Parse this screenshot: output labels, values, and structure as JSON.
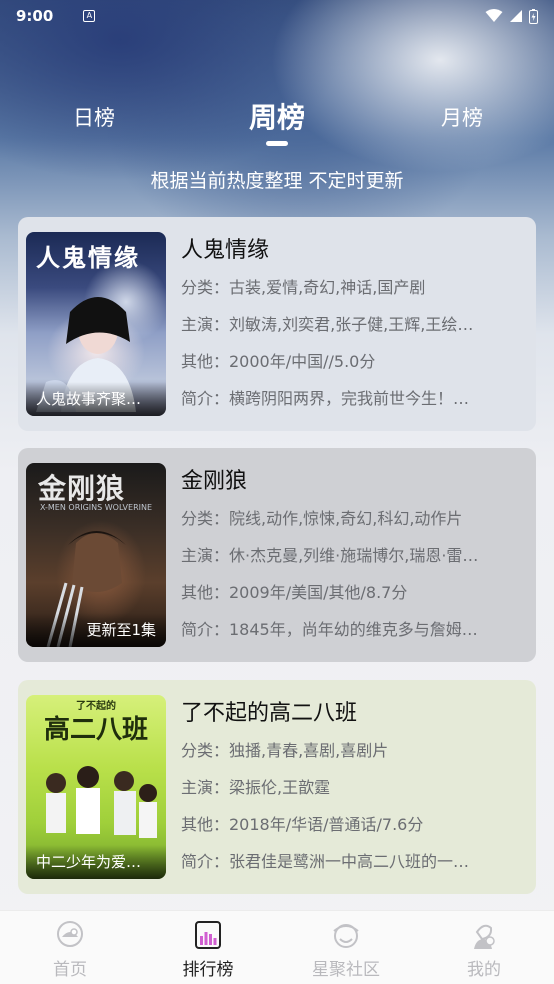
{
  "status_bar": {
    "time": "9:00",
    "notif_letter": "A"
  },
  "tabs": [
    {
      "label": "日榜",
      "active": false
    },
    {
      "label": "周榜",
      "active": true
    },
    {
      "label": "月榜",
      "active": false
    }
  ],
  "subtitle": "根据当前热度整理 不定时更新",
  "items": [
    {
      "title": "人鬼情缘",
      "poster_title": "人鬼情缘",
      "poster_caption": "人鬼故事齐聚…",
      "category": "分类：古装,爱情,奇幻,神话,国产剧",
      "cast": "主演：刘敏涛,刘奕君,张子健,王辉,王绘…",
      "other": "其他：2000年/中国//5.0分",
      "intro": "简介：横跨阴阳两界，完我前世今生！…"
    },
    {
      "title": "金刚狼",
      "poster_title": "金刚狼",
      "poster_subtitle": "X-MEN ORIGINS WOLVERINE",
      "poster_caption": "更新至1集",
      "category": "分类：院线,动作,惊悚,奇幻,科幻,动作片",
      "cast": "主演：休·杰克曼,列维·施瑞博尔,瑞恩·雷…",
      "other": "其他：2009年/美国/其他/8.7分",
      "intro": "简介：1845年，尚年幼的维克多与詹姆…"
    },
    {
      "title": "了不起的高二八班",
      "poster_title": "高二八班",
      "poster_small": "了不起的",
      "poster_caption": "中二少年为爱…",
      "category": "分类：独播,青春,喜剧,喜剧片",
      "cast": "主演：梁振伦,王歆霆",
      "other": "其他：2018年/华语/普通话/7.6分",
      "intro": "简介：张君佳是鹭洲一中高二八班的一…"
    }
  ],
  "bottom_nav": [
    {
      "label": "首页",
      "icon": "home-icon",
      "active": false
    },
    {
      "label": "排行榜",
      "icon": "ranking-icon",
      "active": true
    },
    {
      "label": "星聚社区",
      "icon": "community-icon",
      "active": false
    },
    {
      "label": "我的",
      "icon": "profile-icon",
      "active": false
    }
  ]
}
